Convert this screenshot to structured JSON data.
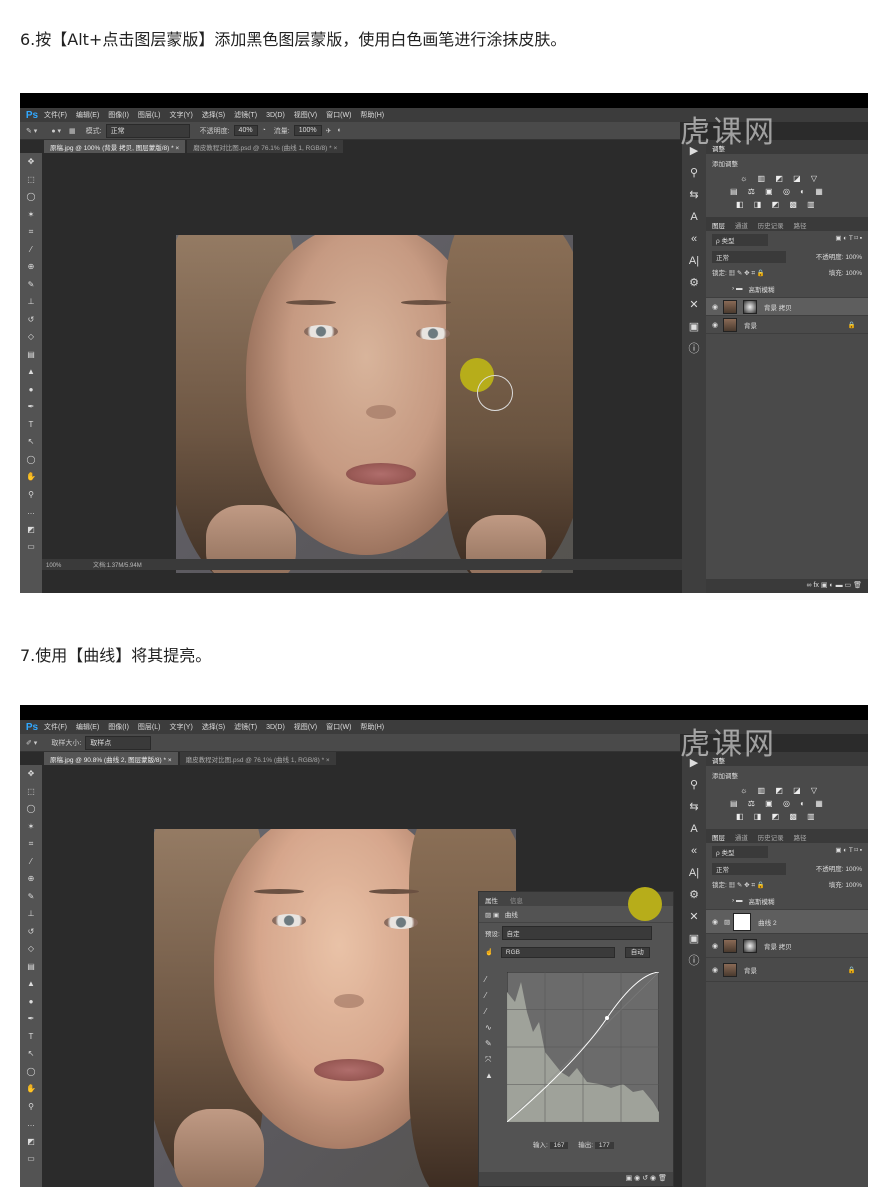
{
  "step6": {
    "text": "6.按【Alt+点击图层蒙版】添加黑色图层蒙版，使用白色画笔进行涂抹皮肤。"
  },
  "step7": {
    "text": "7.使用【曲线】将其提亮。"
  },
  "watermark": "虎课网",
  "ps": {
    "logo": "Ps",
    "menu": [
      "文件(F)",
      "编辑(E)",
      "图像(I)",
      "图层(L)",
      "文字(Y)",
      "选择(S)",
      "滤镜(T)",
      "3D(D)",
      "视图(V)",
      "窗口(W)",
      "帮助(H)"
    ]
  },
  "shot1": {
    "options": {
      "mode_label": "模式:",
      "mode_value": "正常",
      "opacity_label": "不透明度:",
      "opacity_value": "40%",
      "flow_label": "流量:",
      "flow_value": "100%"
    },
    "tabs": [
      "原稿.jpg @ 100% (背景 拷贝, 图层蒙版/8) * ×",
      "磨皮教程对比图.psd @ 76.1% (曲线 1, RGB/8) * ×"
    ],
    "status": {
      "zoom": "100%",
      "doc": "文档:1.37M/5.94M"
    },
    "panel": {
      "adjust_tab": "调整",
      "add_adjust": "添加调整",
      "adj_icons": [
        "☼ ▥ ◩ ◪ ▽",
        "▤ ⚖ ▣ ◎ ◐ ▦",
        "◧ ◨ ◩ ▩ ▥"
      ],
      "tabs": [
        "图层",
        "通道",
        "历史记录",
        "路径"
      ],
      "kind": "ρ 类型",
      "blend": "正常",
      "opacity_label": "不透明度:",
      "opacity": "100%",
      "lock_label": "锁定:",
      "fill_label": "填充:",
      "fill": "100%",
      "layers": [
        {
          "name": "高斯模糊",
          "type": "group"
        },
        {
          "name": "背景 拷贝",
          "type": "masked"
        },
        {
          "name": "背景",
          "type": "bg"
        }
      ]
    }
  },
  "shot2": {
    "options": {
      "sample_label": "取样大小:",
      "sample_value": "取样点"
    },
    "tabs": [
      "原稿.jpg @ 90.8% (曲线 2, 图层蒙版/8) * ×",
      "磨皮教程对比图.psd @ 76.1% (曲线 1, RGB/8) * ×"
    ],
    "panel": {
      "adjust_tab": "调整",
      "add_adjust": "添加调整",
      "adj_icons": [
        "☼ ▥ ◩ ◪ ▽",
        "▤ ⚖ ▣ ◎ ◐ ▦",
        "◧ ◨ ◩ ▩ ▥"
      ],
      "tabs": [
        "图层",
        "通道",
        "历史记录",
        "路径"
      ],
      "kind": "ρ 类型",
      "blend": "正常",
      "opacity_label": "不透明度:",
      "opacity": "100%",
      "lock_label": "锁定:",
      "fill_label": "填充:",
      "fill": "100%",
      "layers": [
        {
          "name": "高斯模糊",
          "type": "group"
        },
        {
          "name": "曲线 2",
          "type": "curve"
        },
        {
          "name": "背景 拷贝",
          "type": "masked"
        },
        {
          "name": "背景",
          "type": "bg"
        }
      ]
    },
    "props": {
      "tabs": [
        "属性",
        "信息"
      ],
      "title": "曲线",
      "preset_label": "预设:",
      "preset_value": "自定",
      "channel": "RGB",
      "auto": "自动",
      "input_label": "输入:",
      "input_value": "167",
      "output_label": "输出:",
      "output_value": "177"
    }
  },
  "colors": {
    "accent": "#31a8ff",
    "brush": "#b7ad1a"
  }
}
